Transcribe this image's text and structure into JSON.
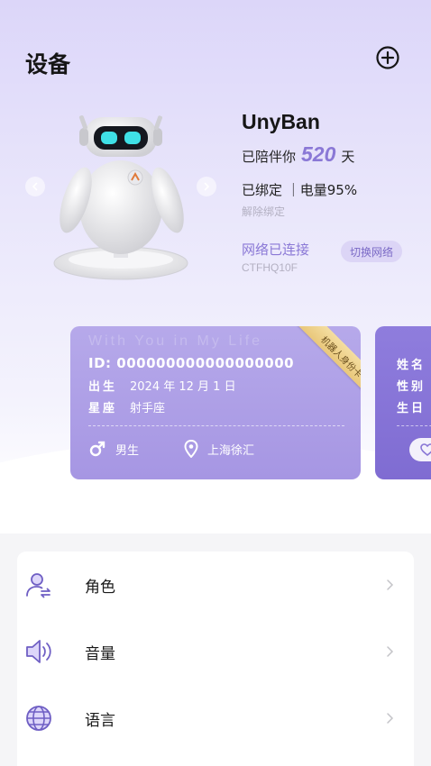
{
  "header": {
    "title": "设备",
    "add_icon": "plus-circle-icon"
  },
  "device": {
    "name": "UnyBan",
    "companion_prefix": "已陪伴你",
    "companion_days": "520",
    "companion_suffix": "天",
    "bind_status": "已绑定 ｜电量95%",
    "unbind_label": "解除绑定",
    "network_status": "网络已连接",
    "ssid": "CTFHQ10F",
    "switch_network_label": "切换网络"
  },
  "id_card": {
    "watermark": "With You in My Life",
    "id_line": "ID: 000000000000000000",
    "birth_label": "出生",
    "birth_value": "2024 年 12 月 1 日",
    "zodiac_label": "星座",
    "zodiac_value": "射手座",
    "gender": "男生",
    "location": "上海徐汇",
    "ribbon": "机器人身份卡"
  },
  "id_card_next": {
    "name_label": "姓名",
    "gender_label": "性别",
    "birthday_label": "生日"
  },
  "menu": {
    "items": [
      {
        "label": "角色",
        "icon": "role-user-icon"
      },
      {
        "label": "音量",
        "icon": "volume-speaker-icon"
      },
      {
        "label": "语言",
        "icon": "globe-language-icon"
      }
    ]
  },
  "colors": {
    "accent": "#8a78d6",
    "card": "#a99ae5",
    "card_dark": "#8673d8"
  }
}
